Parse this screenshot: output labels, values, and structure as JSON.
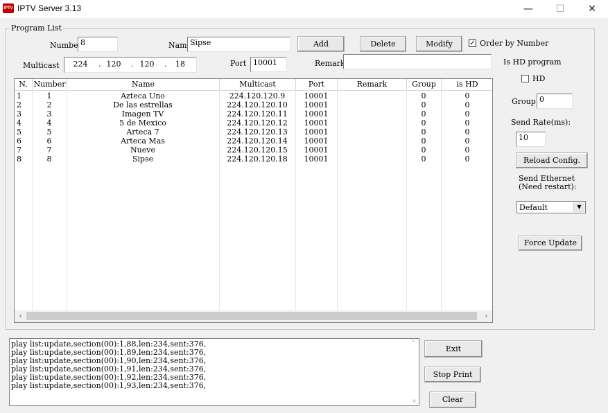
{
  "window": {
    "icon_text": "IPTV",
    "title": "IPTV Server 3.13",
    "minimize_glyph": "—",
    "maximize_glyph": "☐",
    "close_glyph": "✕"
  },
  "program_list": {
    "legend": "Program List",
    "number_label": "Number",
    "number_value": "8",
    "name_label": "Name",
    "name_value": "Sipse",
    "multicast_label": "Multicast",
    "multicast": [
      "224",
      "120",
      "120",
      "18"
    ],
    "port_label": "Port",
    "port_value": "10001",
    "remark_label": "Remark",
    "remark_value": "",
    "add_label": "Add",
    "delete_label": "Delete",
    "modify_label": "Modify",
    "order_by_number_label": "Order by Number",
    "order_by_number_checked": true
  },
  "table": {
    "columns": [
      "N.",
      "Number",
      "Name",
      "Multicast",
      "Port",
      "Remark",
      "Group",
      "is HD"
    ],
    "rows": [
      [
        "1",
        "1",
        "Azteca Uno",
        "224.120.120.9",
        "10001",
        "",
        "0",
        "0"
      ],
      [
        "2",
        "2",
        "De las estrellas",
        "224.120.120.10",
        "10001",
        "",
        "0",
        "0"
      ],
      [
        "3",
        "3",
        "Imagen TV",
        "224.120.120.11",
        "10001",
        "",
        "0",
        "0"
      ],
      [
        "4",
        "4",
        "5 de Mexico",
        "224.120.120.12",
        "10001",
        "",
        "0",
        "0"
      ],
      [
        "5",
        "5",
        "Arteca 7",
        "224.120.120.13",
        "10001",
        "",
        "0",
        "0"
      ],
      [
        "6",
        "6",
        "Arteca Mas",
        "224.120.120.14",
        "10001",
        "",
        "0",
        "0"
      ],
      [
        "7",
        "7",
        "Nueve",
        "224.120.120.15",
        "10001",
        "",
        "0",
        "0"
      ],
      [
        "8",
        "8",
        "Sipse",
        "224.120.120.18",
        "10001",
        "",
        "0",
        "0"
      ]
    ],
    "scroll_left_icon": "‹",
    "scroll_right_icon": "›"
  },
  "side_panel": {
    "is_hd_program_label": "Is HD program",
    "hd_label": "HD",
    "hd_checked": false,
    "group_label": "Group",
    "group_value": "0",
    "send_rate_label": "Send Rate(ms):",
    "send_rate_value": "10",
    "reload_config_label": "Reload Config.",
    "send_ethernet_label_1": "Send Ethernet",
    "send_ethernet_label_2": "(Need restart):",
    "ethernet_selected": "Default",
    "force_update_label": "Force Update"
  },
  "log": {
    "lines": [
      "play list:update,section(00):1,88,len:234,sent:376,",
      "play list:update,section(00):1,89,len:234,sent:376,",
      "play list:update,section(00):1,90,len:234,sent:376,",
      "play list:update,section(00):1,91,len:234,sent:376,",
      "play list:update,section(00):1,92,len:234,sent:376,",
      "play list:update,section(00):1,93,len:234,sent:376,"
    ]
  },
  "bottom_buttons": {
    "exit_label": "Exit",
    "stop_print_label": "Stop Print",
    "clear_label": "Clear"
  }
}
